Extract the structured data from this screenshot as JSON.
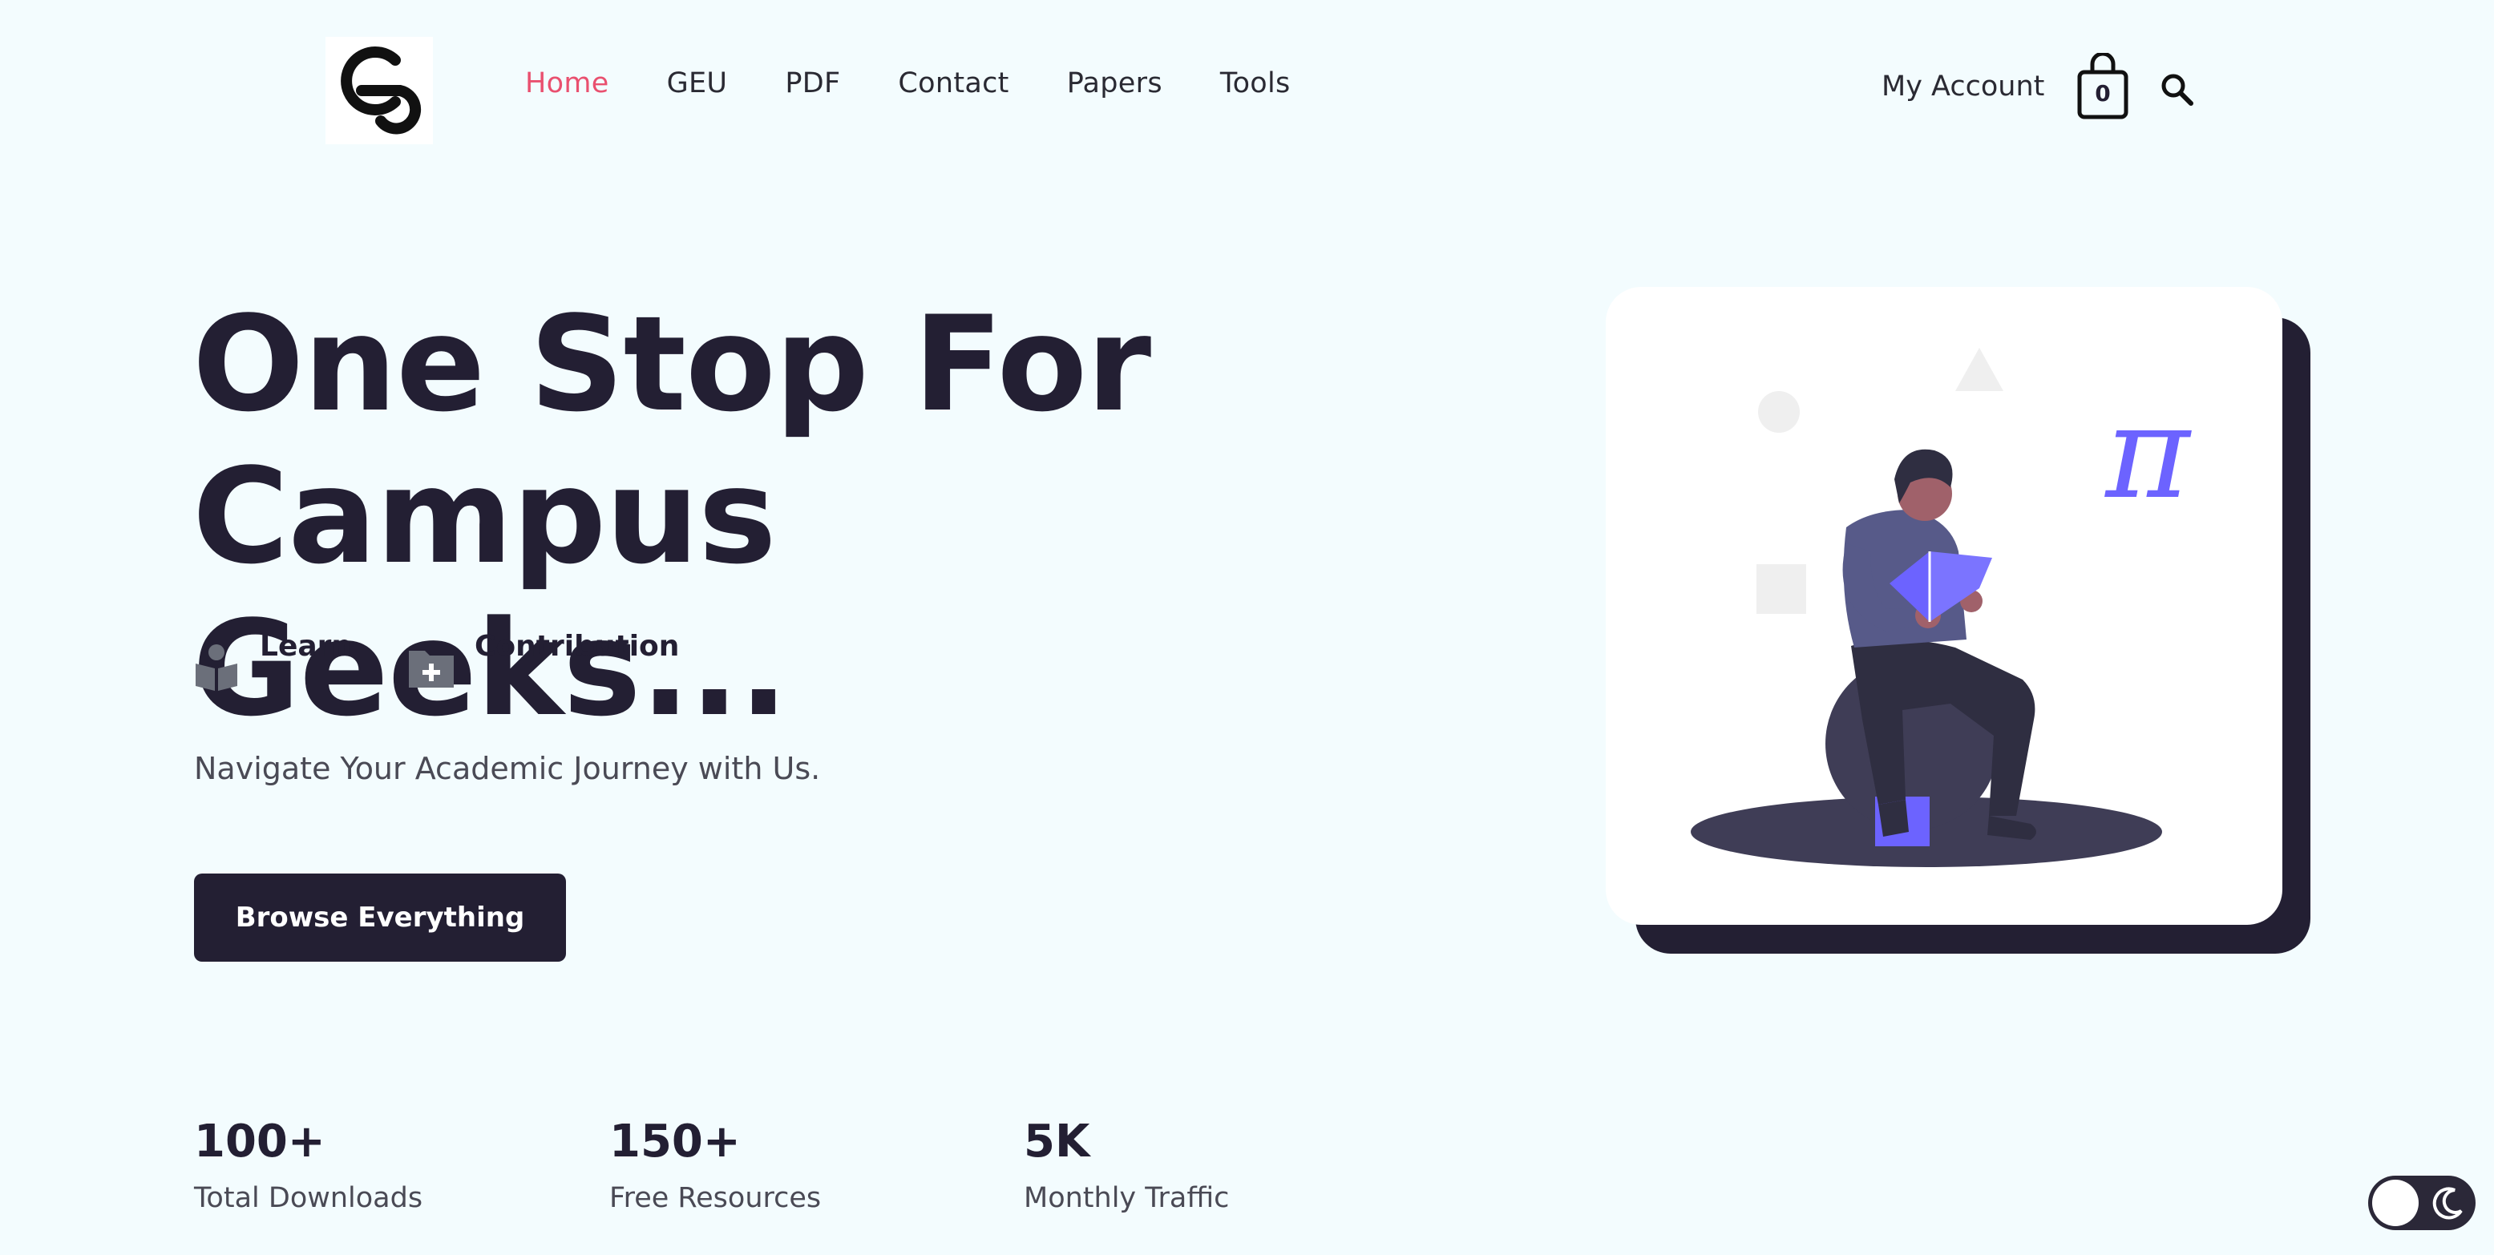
{
  "header": {
    "logo_alt": "CG",
    "nav": [
      {
        "label": "Home",
        "active": true
      },
      {
        "label": "GEU",
        "active": false
      },
      {
        "label": "PDF",
        "active": false
      },
      {
        "label": "Contact",
        "active": false
      },
      {
        "label": "Papers",
        "active": false
      },
      {
        "label": "Tools",
        "active": false
      }
    ],
    "account_label": "My Account",
    "cart_count": "0",
    "icons": {
      "cart": "shopping-bag-icon",
      "search": "search-icon"
    }
  },
  "hero": {
    "title_line1": "One Stop For",
    "title_line2": "Campus Geeks...",
    "features": [
      {
        "label": "Learn",
        "icon": "book-reader-icon"
      },
      {
        "label": "Contribution",
        "icon": "folder-plus-icon"
      }
    ],
    "tagline": "Navigate Your Academic Journey with Us.",
    "cta_label": "Browse Everything"
  },
  "stats": [
    {
      "value": "100+",
      "label": "Total Downloads"
    },
    {
      "value": "150+",
      "label": "Free Resources"
    },
    {
      "value": "5K",
      "label": "Monthly Traffic"
    }
  ],
  "illustration": {
    "symbol": "π"
  },
  "theme": {
    "mode": "light",
    "icons": {
      "toggle": "moon-icon"
    }
  },
  "colors": {
    "accent": "#e9506f",
    "dark": "#231f33",
    "purple": "#6c63ff",
    "background": "#f3fcfe"
  }
}
